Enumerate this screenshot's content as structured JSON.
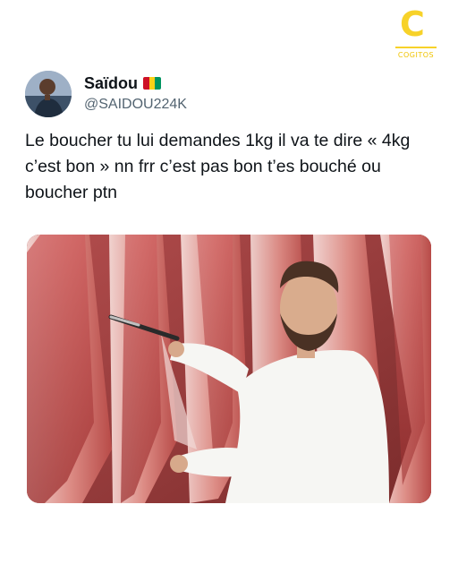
{
  "brand": {
    "logo_letter": "C",
    "logo_text": "COGITOS",
    "color": "#f7d229"
  },
  "tweet": {
    "author_name": "Saïdou",
    "author_handle": "@SAIDOU224K",
    "flag_colors": [
      "#ce1126",
      "#fcd116",
      "#009460"
    ],
    "text": "Le boucher tu lui demandes 1kg il va te dire « 4kg c’est bon » nn frr c’est pas bon t’es bouché ou boucher ptn"
  }
}
